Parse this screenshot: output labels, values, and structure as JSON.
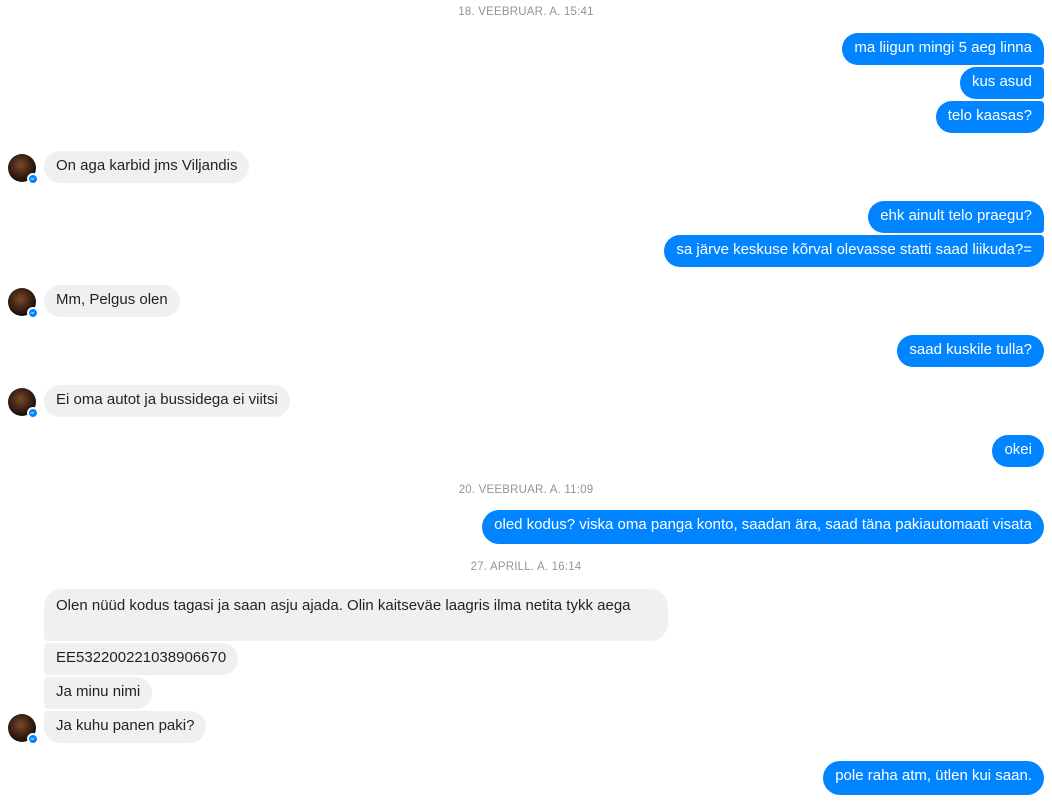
{
  "timestamps": {
    "t1": "18. VEEBRUAR. A. 15:41",
    "t2": "20. VEEBRUAR. A. 11:09",
    "t3": "27. APRILL. A. 16:14"
  },
  "messages": {
    "m1": "ma liigun mingi 5 aeg linna",
    "m2": "kus asud",
    "m3": "telo kaasas?",
    "m4": "On aga karbid jms Viljandis",
    "m5": "ehk ainult telo praegu?",
    "m6": "sa järve keskuse kõrval olevasse statti saad liikuda?=",
    "m7": "Mm, Pelgus olen",
    "m8": "saad kuskile tulla?",
    "m9": "Ei oma autot ja bussidega ei viitsi",
    "m10": "okei",
    "m11": "oled kodus? viska oma panga konto, saadan ära, saad täna pakiautomaati visata",
    "m12": "Olen nüüd kodus tagasi ja saan asju ajada. Olin kaitseväe laagris ilma netita tykk aega",
    "m13": "EE532200221038906670",
    "m14": "Ja minu nimi",
    "m15": "Ja kuhu panen paki?",
    "m16": "pole raha atm, ütlen kui saan."
  },
  "icons": {
    "avatar": "contact-avatar",
    "badge": "messenger-badge-icon"
  },
  "colors": {
    "outgoing": "#0084ff",
    "incoming": "#f1f0f0",
    "timestamp": "#90949c"
  }
}
